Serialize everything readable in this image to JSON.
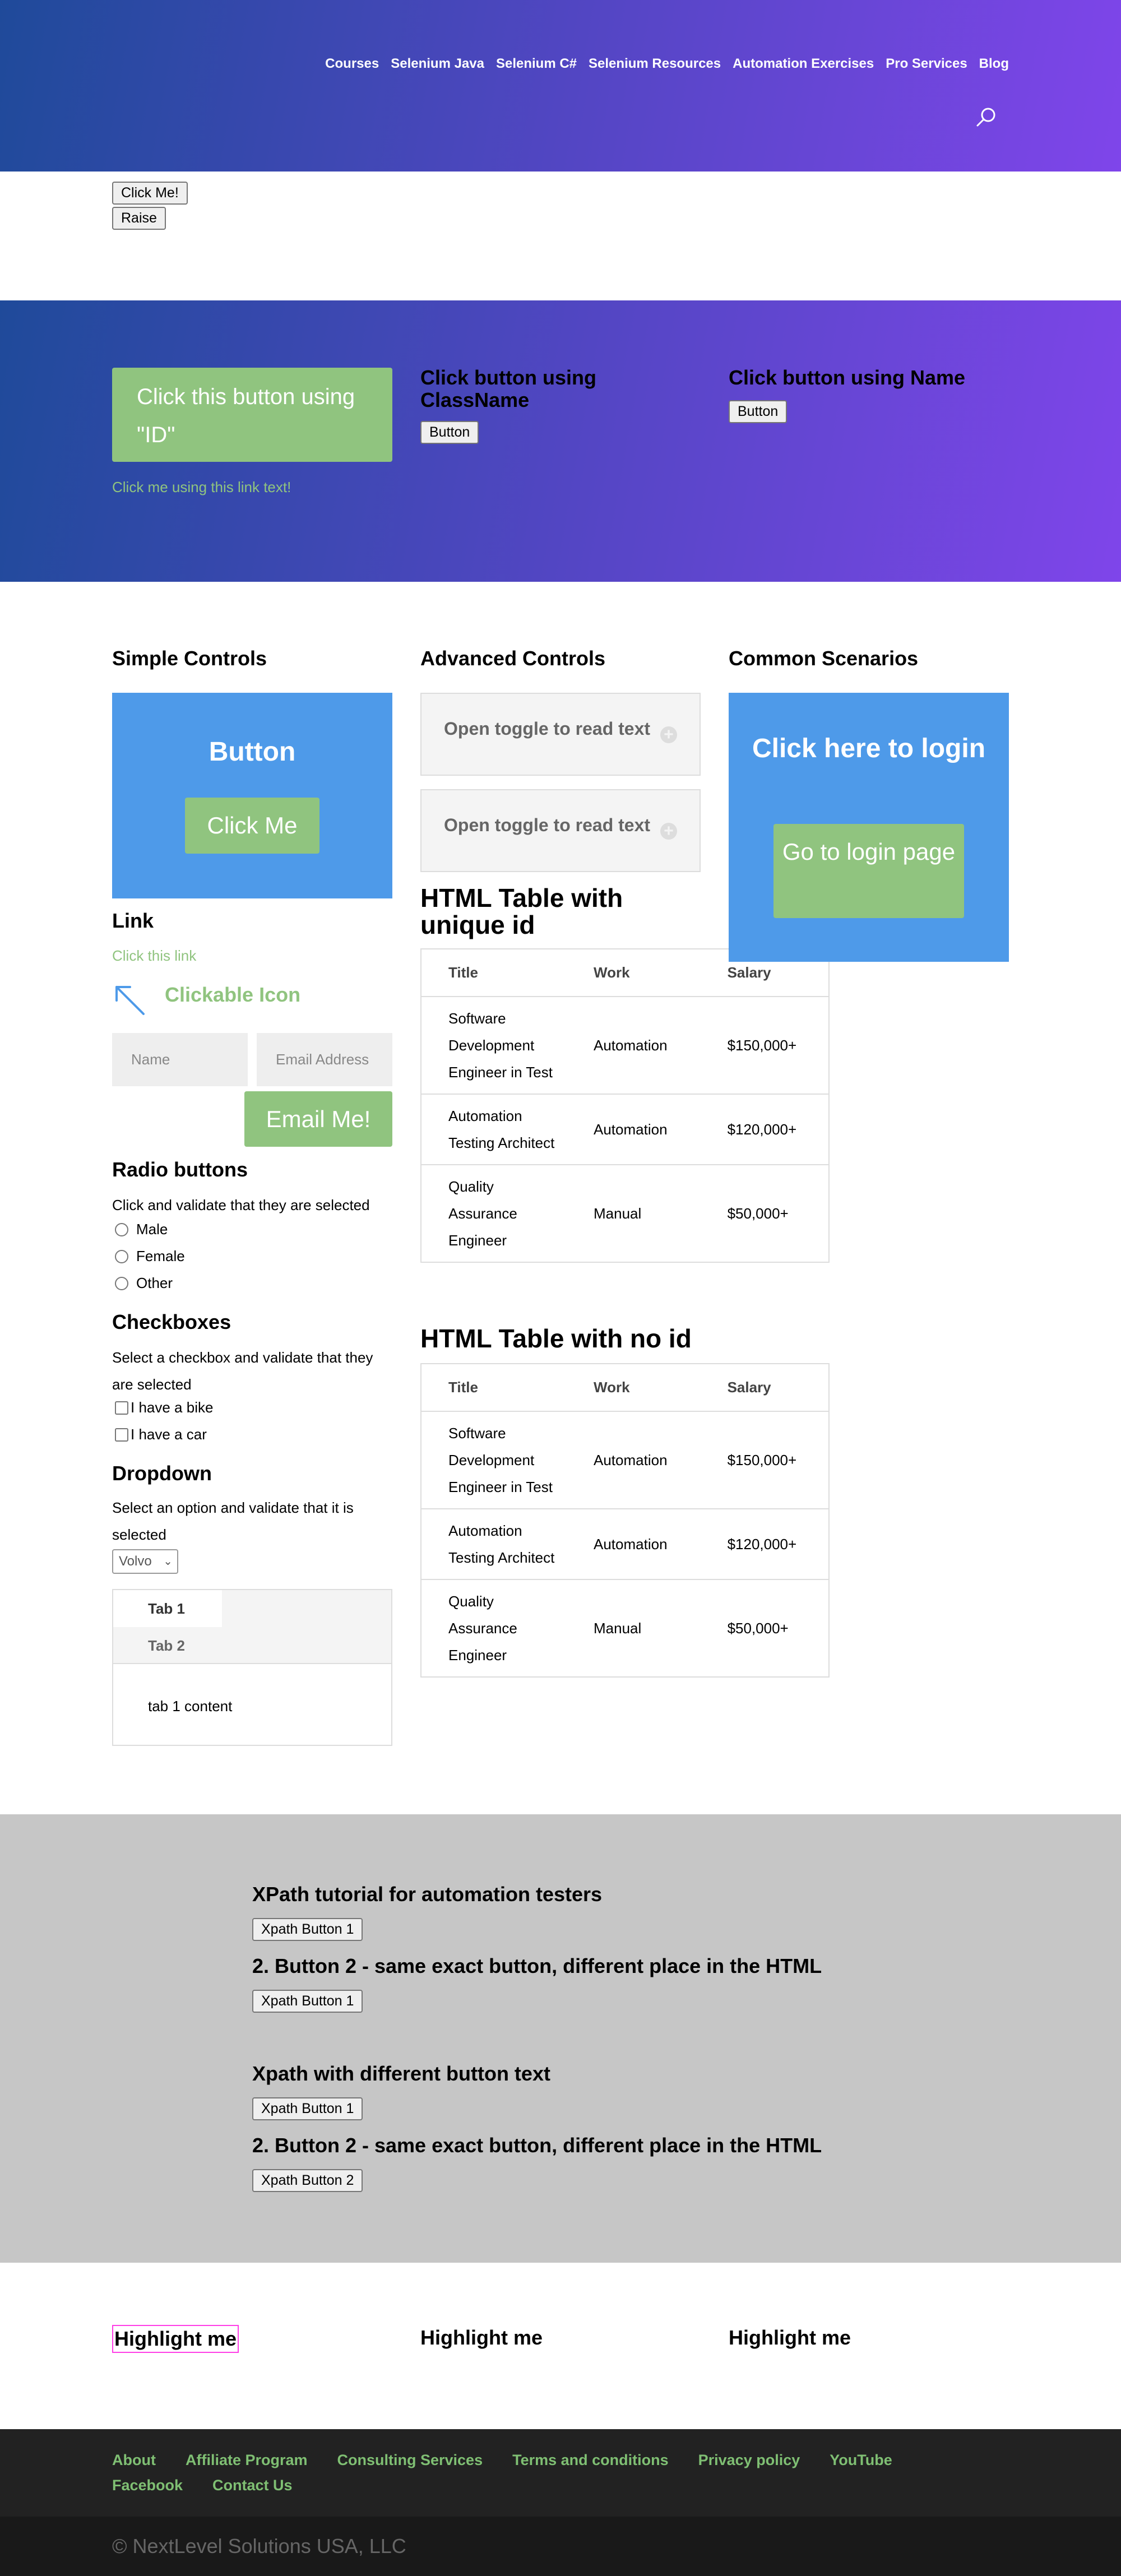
{
  "nav": {
    "items": [
      "Courses",
      "Selenium Java",
      "Selenium C#",
      "Selenium Resources",
      "Automation Exercises",
      "Pro Services",
      "Blog"
    ]
  },
  "top_buttons": {
    "click_me": "Click Me!",
    "raise": "Raise"
  },
  "locators": {
    "id_button": "Click this button using \"ID\"",
    "link_text": "Click me using this link text!",
    "classname_heading": "Click button using ClassName",
    "classname_button": "Button",
    "name_heading": "Click button using Name",
    "name_button": "Button"
  },
  "simple_controls": {
    "heading": "Simple Controls",
    "box_title": "Button",
    "box_button": "Click Me",
    "link_heading": "Link",
    "link_text": "Click this link",
    "icon_label": "Clickable Icon",
    "name_placeholder": "Name",
    "email_placeholder": "Email Address",
    "email_button": "Email Me!",
    "radio_heading": "Radio buttons",
    "radio_desc": "Click and validate that they are selected",
    "radio_options": [
      "Male",
      "Female",
      "Other"
    ],
    "checkbox_heading": "Checkboxes",
    "checkbox_desc": "Select a checkbox and validate that they are selected",
    "checkbox_options": [
      "I have a bike",
      "I have a car"
    ],
    "dropdown_heading": "Dropdown",
    "dropdown_desc": "Select an option and validate that it is selected",
    "dropdown_value": "Volvo",
    "tabs": [
      "Tab 1",
      "Tab 2"
    ],
    "tab_content": "tab 1 content"
  },
  "advanced_controls": {
    "heading": "Advanced Controls",
    "toggles": [
      "Open toggle to read text",
      "Open toggle to read text"
    ],
    "table1_heading": "HTML Table with unique id",
    "table2_heading": "HTML Table with no id",
    "table_headers": [
      "Title",
      "Work",
      "Salary"
    ],
    "table_rows": [
      [
        "Software Development Engineer in Test",
        "Automation",
        "$150,000+"
      ],
      [
        "Automation Testing Architect",
        "Automation",
        "$120,000+"
      ],
      [
        "Quality Assurance Engineer",
        "Manual",
        "$50,000+"
      ]
    ]
  },
  "common_scenarios": {
    "heading": "Common Scenarios",
    "box_title": "Click here to login",
    "login_button": "Go to login page"
  },
  "xpath": {
    "h1": "XPath tutorial for automation testers",
    "b1": "Xpath Button 1",
    "h2": "2. Button 2 - same exact button, different place in the HTML",
    "b2": "Xpath Button 1",
    "h3": "Xpath with different button text",
    "b3": "Xpath Button 1",
    "h4": "2. Button 2 - same exact button, different place in the HTML",
    "b4": "Xpath Button 2"
  },
  "highlight": [
    "Highlight me",
    "Highlight me",
    "Highlight me"
  ],
  "footer": {
    "links": [
      "About",
      "Affiliate Program",
      "Consulting Services",
      "Terms and conditions",
      "Privacy policy",
      "YouTube",
      "Facebook",
      "Contact Us"
    ],
    "copyright": "© NextLevel Solutions USA, LLC"
  },
  "colors": {
    "accent_green": "#90c47f",
    "box_blue": "#4e9ae9",
    "gradient_start": "#1f4a9a",
    "gradient_end": "#7f45ea",
    "highlight_border": "#ff3fe6"
  }
}
